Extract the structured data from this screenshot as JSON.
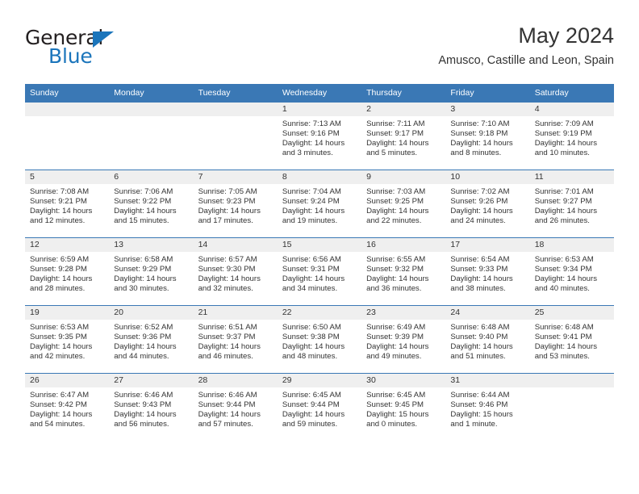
{
  "brand": {
    "word1": "General",
    "word2": "Blue",
    "triangle_color": "#1b75bb"
  },
  "header": {
    "title": "May 2024",
    "subtitle": "Amusco, Castille and Leon, Spain"
  },
  "theme": {
    "header_row_bg": "#3a78b5",
    "daynum_bg": "#efefef",
    "text": "#333333"
  },
  "weekday_headers": [
    "Sunday",
    "Monday",
    "Tuesday",
    "Wednesday",
    "Thursday",
    "Friday",
    "Saturday"
  ],
  "weeks": [
    [
      {
        "day": "",
        "sunrise": "",
        "sunset": "",
        "daylight": "",
        "daylight2": "",
        "empty": true
      },
      {
        "day": "",
        "sunrise": "",
        "sunset": "",
        "daylight": "",
        "daylight2": "",
        "empty": true
      },
      {
        "day": "",
        "sunrise": "",
        "sunset": "",
        "daylight": "",
        "daylight2": "",
        "empty": true
      },
      {
        "day": "1",
        "sunrise": "Sunrise: 7:13 AM",
        "sunset": "Sunset: 9:16 PM",
        "daylight": "Daylight: 14 hours",
        "daylight2": "and 3 minutes."
      },
      {
        "day": "2",
        "sunrise": "Sunrise: 7:11 AM",
        "sunset": "Sunset: 9:17 PM",
        "daylight": "Daylight: 14 hours",
        "daylight2": "and 5 minutes."
      },
      {
        "day": "3",
        "sunrise": "Sunrise: 7:10 AM",
        "sunset": "Sunset: 9:18 PM",
        "daylight": "Daylight: 14 hours",
        "daylight2": "and 8 minutes."
      },
      {
        "day": "4",
        "sunrise": "Sunrise: 7:09 AM",
        "sunset": "Sunset: 9:19 PM",
        "daylight": "Daylight: 14 hours",
        "daylight2": "and 10 minutes."
      }
    ],
    [
      {
        "day": "5",
        "sunrise": "Sunrise: 7:08 AM",
        "sunset": "Sunset: 9:21 PM",
        "daylight": "Daylight: 14 hours",
        "daylight2": "and 12 minutes."
      },
      {
        "day": "6",
        "sunrise": "Sunrise: 7:06 AM",
        "sunset": "Sunset: 9:22 PM",
        "daylight": "Daylight: 14 hours",
        "daylight2": "and 15 minutes."
      },
      {
        "day": "7",
        "sunrise": "Sunrise: 7:05 AM",
        "sunset": "Sunset: 9:23 PM",
        "daylight": "Daylight: 14 hours",
        "daylight2": "and 17 minutes."
      },
      {
        "day": "8",
        "sunrise": "Sunrise: 7:04 AM",
        "sunset": "Sunset: 9:24 PM",
        "daylight": "Daylight: 14 hours",
        "daylight2": "and 19 minutes."
      },
      {
        "day": "9",
        "sunrise": "Sunrise: 7:03 AM",
        "sunset": "Sunset: 9:25 PM",
        "daylight": "Daylight: 14 hours",
        "daylight2": "and 22 minutes."
      },
      {
        "day": "10",
        "sunrise": "Sunrise: 7:02 AM",
        "sunset": "Sunset: 9:26 PM",
        "daylight": "Daylight: 14 hours",
        "daylight2": "and 24 minutes."
      },
      {
        "day": "11",
        "sunrise": "Sunrise: 7:01 AM",
        "sunset": "Sunset: 9:27 PM",
        "daylight": "Daylight: 14 hours",
        "daylight2": "and 26 minutes."
      }
    ],
    [
      {
        "day": "12",
        "sunrise": "Sunrise: 6:59 AM",
        "sunset": "Sunset: 9:28 PM",
        "daylight": "Daylight: 14 hours",
        "daylight2": "and 28 minutes."
      },
      {
        "day": "13",
        "sunrise": "Sunrise: 6:58 AM",
        "sunset": "Sunset: 9:29 PM",
        "daylight": "Daylight: 14 hours",
        "daylight2": "and 30 minutes."
      },
      {
        "day": "14",
        "sunrise": "Sunrise: 6:57 AM",
        "sunset": "Sunset: 9:30 PM",
        "daylight": "Daylight: 14 hours",
        "daylight2": "and 32 minutes."
      },
      {
        "day": "15",
        "sunrise": "Sunrise: 6:56 AM",
        "sunset": "Sunset: 9:31 PM",
        "daylight": "Daylight: 14 hours",
        "daylight2": "and 34 minutes."
      },
      {
        "day": "16",
        "sunrise": "Sunrise: 6:55 AM",
        "sunset": "Sunset: 9:32 PM",
        "daylight": "Daylight: 14 hours",
        "daylight2": "and 36 minutes."
      },
      {
        "day": "17",
        "sunrise": "Sunrise: 6:54 AM",
        "sunset": "Sunset: 9:33 PM",
        "daylight": "Daylight: 14 hours",
        "daylight2": "and 38 minutes."
      },
      {
        "day": "18",
        "sunrise": "Sunrise: 6:53 AM",
        "sunset": "Sunset: 9:34 PM",
        "daylight": "Daylight: 14 hours",
        "daylight2": "and 40 minutes."
      }
    ],
    [
      {
        "day": "19",
        "sunrise": "Sunrise: 6:53 AM",
        "sunset": "Sunset: 9:35 PM",
        "daylight": "Daylight: 14 hours",
        "daylight2": "and 42 minutes."
      },
      {
        "day": "20",
        "sunrise": "Sunrise: 6:52 AM",
        "sunset": "Sunset: 9:36 PM",
        "daylight": "Daylight: 14 hours",
        "daylight2": "and 44 minutes."
      },
      {
        "day": "21",
        "sunrise": "Sunrise: 6:51 AM",
        "sunset": "Sunset: 9:37 PM",
        "daylight": "Daylight: 14 hours",
        "daylight2": "and 46 minutes."
      },
      {
        "day": "22",
        "sunrise": "Sunrise: 6:50 AM",
        "sunset": "Sunset: 9:38 PM",
        "daylight": "Daylight: 14 hours",
        "daylight2": "and 48 minutes."
      },
      {
        "day": "23",
        "sunrise": "Sunrise: 6:49 AM",
        "sunset": "Sunset: 9:39 PM",
        "daylight": "Daylight: 14 hours",
        "daylight2": "and 49 minutes."
      },
      {
        "day": "24",
        "sunrise": "Sunrise: 6:48 AM",
        "sunset": "Sunset: 9:40 PM",
        "daylight": "Daylight: 14 hours",
        "daylight2": "and 51 minutes."
      },
      {
        "day": "25",
        "sunrise": "Sunrise: 6:48 AM",
        "sunset": "Sunset: 9:41 PM",
        "daylight": "Daylight: 14 hours",
        "daylight2": "and 53 minutes."
      }
    ],
    [
      {
        "day": "26",
        "sunrise": "Sunrise: 6:47 AM",
        "sunset": "Sunset: 9:42 PM",
        "daylight": "Daylight: 14 hours",
        "daylight2": "and 54 minutes."
      },
      {
        "day": "27",
        "sunrise": "Sunrise: 6:46 AM",
        "sunset": "Sunset: 9:43 PM",
        "daylight": "Daylight: 14 hours",
        "daylight2": "and 56 minutes."
      },
      {
        "day": "28",
        "sunrise": "Sunrise: 6:46 AM",
        "sunset": "Sunset: 9:44 PM",
        "daylight": "Daylight: 14 hours",
        "daylight2": "and 57 minutes."
      },
      {
        "day": "29",
        "sunrise": "Sunrise: 6:45 AM",
        "sunset": "Sunset: 9:44 PM",
        "daylight": "Daylight: 14 hours",
        "daylight2": "and 59 minutes."
      },
      {
        "day": "30",
        "sunrise": "Sunrise: 6:45 AM",
        "sunset": "Sunset: 9:45 PM",
        "daylight": "Daylight: 15 hours",
        "daylight2": "and 0 minutes."
      },
      {
        "day": "31",
        "sunrise": "Sunrise: 6:44 AM",
        "sunset": "Sunset: 9:46 PM",
        "daylight": "Daylight: 15 hours",
        "daylight2": "and 1 minute."
      },
      {
        "day": "",
        "sunrise": "",
        "sunset": "",
        "daylight": "",
        "daylight2": "",
        "empty": true
      }
    ]
  ]
}
